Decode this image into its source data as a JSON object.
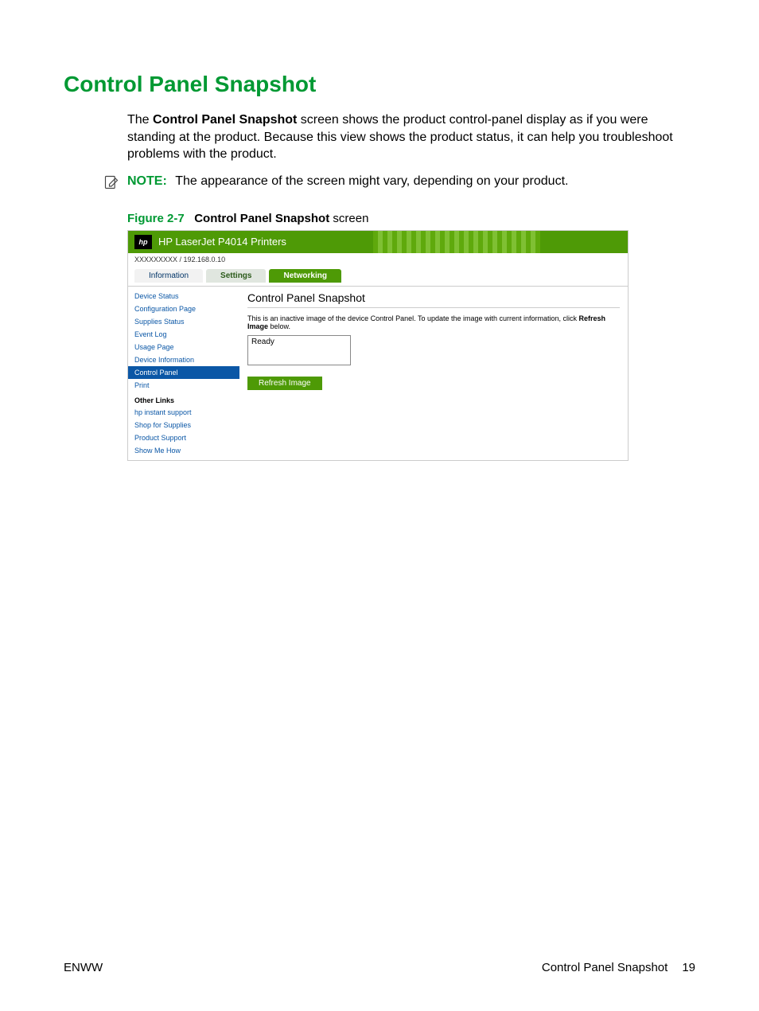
{
  "heading": "Control Panel Snapshot",
  "paragraph_pre": "The ",
  "paragraph_bold": "Control Panel Snapshot",
  "paragraph_post": " screen shows the product control-panel display as if you were standing at the product. Because this view shows the product status, it can help you troubleshoot problems with the product.",
  "note_label": "NOTE:",
  "note_text": "The appearance of the screen might vary, depending on your product.",
  "figure": {
    "num": "Figure 2-7",
    "bold": "Control Panel Snapshot",
    "rest": " screen"
  },
  "screenshot": {
    "hp_glyph": "hp",
    "title": "HP LaserJet P4014 Printers",
    "address": "XXXXXXXXX / 192.168.0.10",
    "tabs": {
      "info": "Information",
      "settings": "Settings",
      "net": "Networking"
    },
    "side": {
      "items": [
        "Device Status",
        "Configuration Page",
        "Supplies Status",
        "Event Log",
        "Usage Page",
        "Device Information",
        "Control Panel",
        "Print"
      ],
      "other_links_head": "Other Links",
      "links": [
        "hp instant support",
        "Shop for Supplies",
        "Product Support",
        "Show Me How"
      ]
    },
    "main": {
      "title": "Control Panel Snapshot",
      "desc_pre": "This is an inactive image of the device Control Panel. To update the image with current information, click ",
      "desc_bold": "Refresh Image",
      "desc_post": " below.",
      "display_text": "Ready",
      "button": "Refresh Image"
    }
  },
  "footer": {
    "left": "ENWW",
    "right_label": "Control Panel Snapshot",
    "page": "19"
  }
}
